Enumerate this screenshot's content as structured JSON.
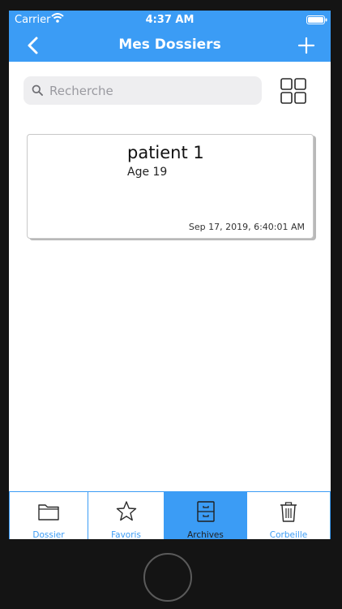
{
  "status_bar": {
    "carrier": "Carrier",
    "time": "4:37 AM"
  },
  "header": {
    "title": "Mes Dossiers",
    "back_icon": "chevron-left-icon",
    "add_icon": "plus-icon"
  },
  "search": {
    "placeholder": "Recherche",
    "value": ""
  },
  "patients": [
    {
      "name": "patient 1",
      "age": "Age 19",
      "date": "Sep 17, 2019, 6:40:01 AM"
    }
  ],
  "tabs": [
    {
      "label": "Dossier",
      "icon": "folder-icon",
      "active": false
    },
    {
      "label": "Favoris",
      "icon": "star-icon",
      "active": false
    },
    {
      "label": "Archives",
      "icon": "archive-cabinet-icon",
      "active": true
    },
    {
      "label": "Corbeille",
      "icon": "trash-icon",
      "active": false
    }
  ],
  "colors": {
    "accent": "#3b9cf5",
    "background": "#ffffff",
    "device_frame": "#141414"
  }
}
